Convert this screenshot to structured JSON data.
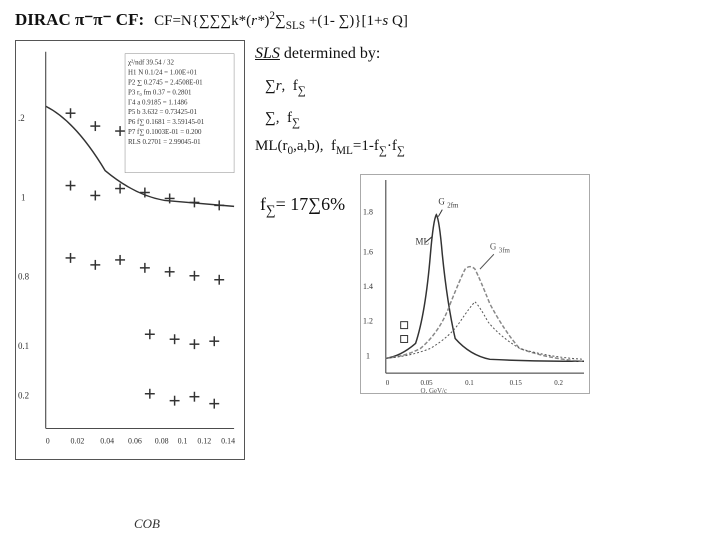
{
  "header": {
    "left_title": "DIRAC π⁻π⁻ CF:",
    "formula": "CF=N{∑∑∑k*(r*)²∑SLS +(1- ∑)}[1+s Q]"
  },
  "sls_section": {
    "title": "SLS determined by:",
    "formula1": "∑r,  f∑",
    "formula2": "∑,  f∑",
    "ml_formula": "ML(r₀,a,b),  f_ML=1-f∑·f∑"
  },
  "bottom": {
    "f_value": "f∑= 17∑6%"
  },
  "right_graph": {
    "label_g2fm": "G₂fm",
    "label_ml": "ML",
    "label_g3fm": "G₃fm"
  },
  "cob_label": "COB"
}
